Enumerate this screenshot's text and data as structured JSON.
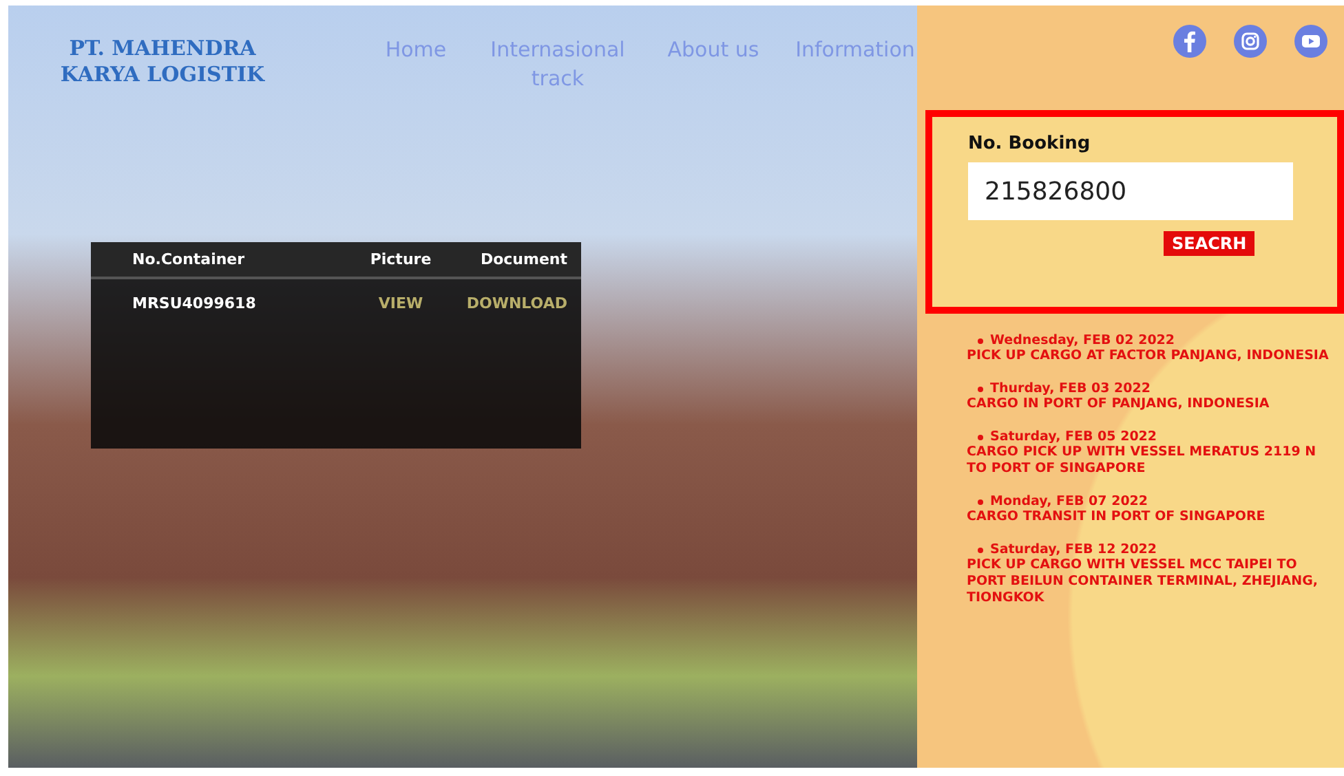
{
  "brand": {
    "lines": [
      "PT. MAHENDRA",
      "KARYA LOGISTIK"
    ]
  },
  "nav": [
    {
      "label": "Home"
    },
    {
      "label": "Internasional track"
    },
    {
      "label": "About us"
    },
    {
      "label": "Information"
    }
  ],
  "table": {
    "columns": [
      "No.Container",
      "Picture",
      "Document"
    ],
    "rows": [
      {
        "container": "MRSU4099618",
        "picture": "VIEW",
        "document": "DOWNLOAD"
      }
    ]
  },
  "social": [
    {
      "kind": "facebook"
    },
    {
      "kind": "instagram"
    },
    {
      "kind": "youtube"
    }
  ],
  "booking": {
    "label": "No. Booking",
    "value": "215826800",
    "button": "SEACRH"
  },
  "timeline": [
    {
      "date": "Wednesday, FEB 02 2022",
      "text": "PICK UP CARGO AT FACTOR PANJANG, INDONESIA"
    },
    {
      "date": "Thurday, FEB 03 2022",
      "text": "CARGO IN PORT OF PANJANG, INDONESIA"
    },
    {
      "date": "Saturday, FEB 05 2022",
      "text": "CARGO PICK UP WITH VESSEL MERATUS 2119 N TO PORT OF SINGAPORE"
    },
    {
      "date": "Monday, FEB 07 2022",
      "text": "CARGO TRANSIT IN PORT OF SINGAPORE"
    },
    {
      "date": "Saturday, FEB 12 2022",
      "text": "PICK UP CARGO WITH VESSEL MCC TAIPEI  TO PORT BEILUN CONTAINER TERMINAL, ZHEJIANG, TIONGKOK"
    }
  ]
}
